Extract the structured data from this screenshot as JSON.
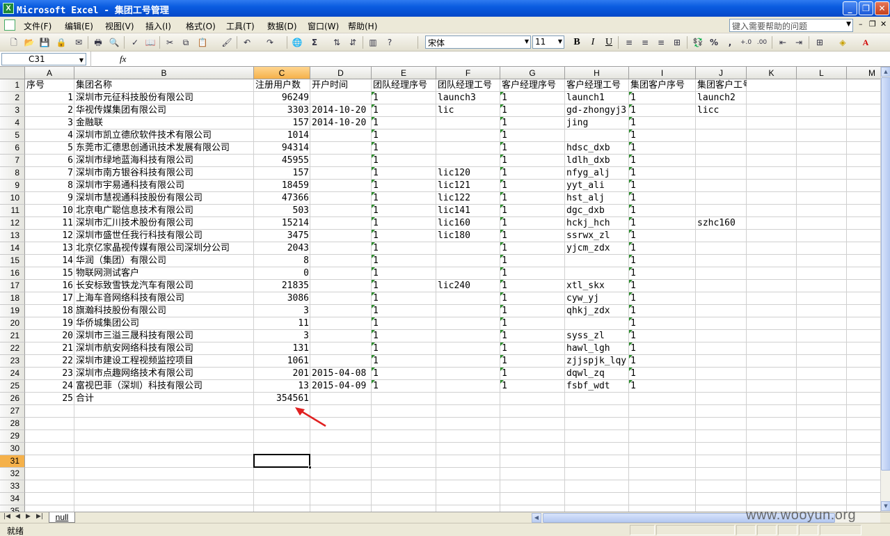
{
  "window": {
    "title": "Microsoft Excel - 集团工号管理",
    "minimize": "_",
    "restore": "❐",
    "close": "✕"
  },
  "menu": {
    "items": [
      "文件(F)",
      "编辑(E)",
      "视图(V)",
      "插入(I)",
      "格式(O)",
      "工具(T)",
      "数据(D)",
      "窗口(W)",
      "帮助(H)"
    ],
    "help_placeholder": "键入需要帮助的问题"
  },
  "toolbar": {
    "font_name": "宋体",
    "font_size": "11",
    "bold": "B",
    "italic": "I",
    "underline": "U",
    "percent": "%",
    "comma": ","
  },
  "formula": {
    "name_box": "C31",
    "fx_label": "fx",
    "content": ""
  },
  "columns": [
    "A",
    "B",
    "C",
    "D",
    "E",
    "F",
    "G",
    "H",
    "I",
    "J",
    "K",
    "L",
    "M"
  ],
  "rows": [
    "1",
    "2",
    "3",
    "4",
    "5",
    "6",
    "7",
    "8",
    "9",
    "10",
    "11",
    "12",
    "13",
    "14",
    "15",
    "16",
    "17",
    "18",
    "19",
    "20",
    "21",
    "22",
    "23",
    "24",
    "25",
    "26",
    "27",
    "28",
    "29",
    "30",
    "31",
    "32",
    "33",
    "34",
    "35"
  ],
  "selected": {
    "column": "C",
    "row": "31"
  },
  "headers": [
    "序号",
    "集团名称",
    "注册用户数",
    "开户时间",
    "团队经理序号",
    "团队经理工号",
    "客户经理序号",
    "客户经理工号",
    "集团客户序号",
    "集团客户工号"
  ],
  "records": [
    {
      "seq": "1",
      "name": "深圳市元征科技股份有限公司",
      "users": "96249",
      "date": "",
      "tm_seq": "1",
      "tm_id": "launch3",
      "cm_seq": "1",
      "cm_id": "launch1",
      "gc_seq": "1",
      "gc_id": "launch2"
    },
    {
      "seq": "2",
      "name": "华视传媒集团有限公司",
      "users": "3303",
      "date": "2014-10-20",
      "tm_seq": "1",
      "tm_id": "lic",
      "cm_seq": "1",
      "cm_id": "gd-zhongyj3",
      "gc_seq": "1",
      "gc_id": "licc"
    },
    {
      "seq": "3",
      "name": "金融联",
      "users": "157",
      "date": "2014-10-20",
      "tm_seq": "1",
      "tm_id": "",
      "cm_seq": "1",
      "cm_id": "jing",
      "gc_seq": "1",
      "gc_id": ""
    },
    {
      "seq": "4",
      "name": "深圳市凯立德欣软件技术有限公司",
      "users": "1014",
      "date": "",
      "tm_seq": "1",
      "tm_id": "",
      "cm_seq": "1",
      "cm_id": "",
      "gc_seq": "1",
      "gc_id": ""
    },
    {
      "seq": "5",
      "name": "东莞市汇德思创通讯技术发展有限公司",
      "users": "94314",
      "date": "",
      "tm_seq": "1",
      "tm_id": "",
      "cm_seq": "1",
      "cm_id": "hdsc_dxb",
      "gc_seq": "1",
      "gc_id": ""
    },
    {
      "seq": "6",
      "name": "深圳市绿地蓝海科技有限公司",
      "users": "45955",
      "date": "",
      "tm_seq": "1",
      "tm_id": "",
      "cm_seq": "1",
      "cm_id": "ldlh_dxb",
      "gc_seq": "1",
      "gc_id": ""
    },
    {
      "seq": "7",
      "name": "深圳市南方银谷科技有限公司",
      "users": "157",
      "date": "",
      "tm_seq": "1",
      "tm_id": "lic120",
      "cm_seq": "1",
      "cm_id": "nfyg_alj",
      "gc_seq": "1",
      "gc_id": ""
    },
    {
      "seq": "8",
      "name": "深圳市宇易通科技有限公司",
      "users": "18459",
      "date": "",
      "tm_seq": "1",
      "tm_id": "lic121",
      "cm_seq": "1",
      "cm_id": "yyt_ali",
      "gc_seq": "1",
      "gc_id": ""
    },
    {
      "seq": "9",
      "name": "深圳市慧视通科技股份有限公司",
      "users": "47366",
      "date": "",
      "tm_seq": "1",
      "tm_id": "lic122",
      "cm_seq": "1",
      "cm_id": "hst_alj",
      "gc_seq": "1",
      "gc_id": ""
    },
    {
      "seq": "10",
      "name": "北京电广聪信息技术有限公司",
      "users": "503",
      "date": "",
      "tm_seq": "1",
      "tm_id": "lic141",
      "cm_seq": "1",
      "cm_id": "dgc_dxb",
      "gc_seq": "1",
      "gc_id": ""
    },
    {
      "seq": "11",
      "name": "深圳市汇川技术股份有限公司",
      "users": "15214",
      "date": "",
      "tm_seq": "1",
      "tm_id": "lic160",
      "cm_seq": "1",
      "cm_id": "hckj_hch",
      "gc_seq": "1",
      "gc_id": "szhc160"
    },
    {
      "seq": "12",
      "name": "深圳市盛世任我行科技有限公司",
      "users": "3475",
      "date": "",
      "tm_seq": "1",
      "tm_id": "lic180",
      "cm_seq": "1",
      "cm_id": "ssrwx_zl",
      "gc_seq": "1",
      "gc_id": ""
    },
    {
      "seq": "13",
      "name": "北京亿家晶视传媒有限公司深圳分公司",
      "users": "2043",
      "date": "",
      "tm_seq": "1",
      "tm_id": "",
      "cm_seq": "1",
      "cm_id": "yjcm_zdx",
      "gc_seq": "1",
      "gc_id": ""
    },
    {
      "seq": "14",
      "name": "华润（集团）有限公司",
      "users": "8",
      "date": "",
      "tm_seq": "1",
      "tm_id": "",
      "cm_seq": "1",
      "cm_id": "",
      "gc_seq": "1",
      "gc_id": ""
    },
    {
      "seq": "15",
      "name": "物联网测试客户",
      "users": "0",
      "date": "",
      "tm_seq": "1",
      "tm_id": "",
      "cm_seq": "1",
      "cm_id": "",
      "gc_seq": "1",
      "gc_id": ""
    },
    {
      "seq": "16",
      "name": "长安标致雪铁龙汽车有限公司",
      "users": "21835",
      "date": "",
      "tm_seq": "1",
      "tm_id": "lic240",
      "cm_seq": "1",
      "cm_id": "xtl_skx",
      "gc_seq": "1",
      "gc_id": ""
    },
    {
      "seq": "17",
      "name": "上海车音网络科技有限公司",
      "users": "3086",
      "date": "",
      "tm_seq": "1",
      "tm_id": "",
      "cm_seq": "1",
      "cm_id": "cyw_yj",
      "gc_seq": "1",
      "gc_id": ""
    },
    {
      "seq": "18",
      "name": "旗瀚科技股份有限公司",
      "users": "3",
      "date": "",
      "tm_seq": "1",
      "tm_id": "",
      "cm_seq": "1",
      "cm_id": "qhkj_zdx",
      "gc_seq": "1",
      "gc_id": ""
    },
    {
      "seq": "19",
      "name": "华侨城集团公司",
      "users": "11",
      "date": "",
      "tm_seq": "1",
      "tm_id": "",
      "cm_seq": "1",
      "cm_id": "",
      "gc_seq": "1",
      "gc_id": ""
    },
    {
      "seq": "20",
      "name": "深圳市三溢三晟科技有限公司",
      "users": "3",
      "date": "",
      "tm_seq": "1",
      "tm_id": "",
      "cm_seq": "1",
      "cm_id": "syss_zl",
      "gc_seq": "1",
      "gc_id": ""
    },
    {
      "seq": "21",
      "name": "深圳市航安网络科技有限公司",
      "users": "131",
      "date": "",
      "tm_seq": "1",
      "tm_id": "",
      "cm_seq": "1",
      "cm_id": "hawl_lgh",
      "gc_seq": "1",
      "gc_id": ""
    },
    {
      "seq": "22",
      "name": "深圳市建设工程视频监控项目",
      "users": "1061",
      "date": "",
      "tm_seq": "1",
      "tm_id": "",
      "cm_seq": "1",
      "cm_id": "zjjspjk_lqy",
      "gc_seq": "1",
      "gc_id": ""
    },
    {
      "seq": "23",
      "name": "深圳市点趣网络技术有限公司",
      "users": "201",
      "date": "2015-04-08",
      "tm_seq": "1",
      "tm_id": "",
      "cm_seq": "1",
      "cm_id": "dqwl_zq",
      "gc_seq": "1",
      "gc_id": ""
    },
    {
      "seq": "24",
      "name": "富视巴菲（深圳）科技有限公司",
      "users": "13",
      "date": "2015-04-09",
      "tm_seq": "1",
      "tm_id": "",
      "cm_seq": "1",
      "cm_id": "fsbf_wdt",
      "gc_seq": "1",
      "gc_id": ""
    }
  ],
  "total": {
    "seq": "25",
    "label": "合计",
    "users": "354561"
  },
  "sheet_tab": "null",
  "status": "就绪",
  "watermark": "www.wooyun.org",
  "colors": {
    "title_bar": "#0a5ce0",
    "selected_header": "#f5b14a",
    "flag_green": "#2a8c2a",
    "arrow_red": "#e02020"
  }
}
